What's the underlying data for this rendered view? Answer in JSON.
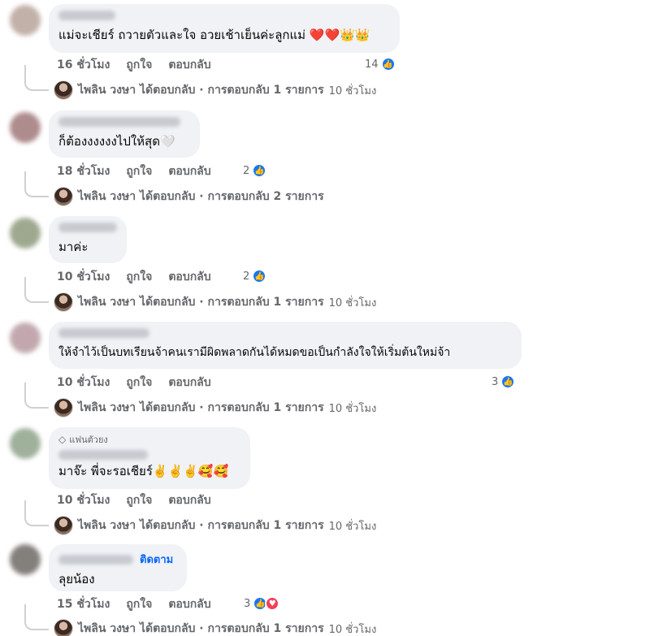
{
  "colors": {
    "bubble": "#f0f2f5",
    "like": "#1877f2",
    "heart": "#f33e58",
    "follow": "#0866ff",
    "muted": "#65676b"
  },
  "actions": {
    "like_label": "ถูกใจ",
    "reply_label": "ตอบกลับ"
  },
  "comments": [
    {
      "text": "แม่จะเชียร์ ถวายตัวและใจ อวยเช้าเย็นค่ะลูกแม่ ❤️❤️👑👑",
      "time": "16 ชั่วโมง",
      "reactions": "14",
      "reply": {
        "text": "ไพลิน วงษา ได้ตอบกลับ · การตอบกลับ 1 รายการ",
        "time": "10 ชั่วโมง"
      }
    },
    {
      "text": "ก็ต้องงงงงงไปให้สุด🤍",
      "time": "18 ชั่วโมง",
      "reactions": "2",
      "reply": {
        "text": "ไพลิน วงษา ได้ตอบกลับ · การตอบกลับ 2 รายการ",
        "time": ""
      }
    },
    {
      "text": "มาค่ะ",
      "time": "10 ชั่วโมง",
      "reactions": "2",
      "reply": {
        "text": "ไพลิน วงษา ได้ตอบกลับ · การตอบกลับ 1 รายการ",
        "time": "10 ชั่วโมง"
      }
    },
    {
      "text": "ให้จำไว้เป็นบทเรียนจ้าคนเรามีผิดพลาดกันได้หมดขอเป็นกำลังใจให้เริ่มต้นใหม่จ้า",
      "time": "10 ชั่วโมง",
      "reactions": "3",
      "reply": {
        "text": "ไพลิน วงษา ได้ตอบกลับ · การตอบกลับ 1 รายการ",
        "time": "10 ชั่วโมง"
      }
    },
    {
      "badge": "แฟนตัวยง",
      "text": "มาจ๊ะ พี่จะรอเชียร์✌️✌️✌️🥰🥰",
      "time": "10 ชั่วโมง",
      "reactions": "",
      "reply": {
        "text": "ไพลิน วงษา ได้ตอบกลับ · การตอบกลับ 1 รายการ",
        "time": "10 ชั่วโมง"
      }
    },
    {
      "follow": "ติดตาม",
      "text": "ลุยน้อง",
      "time": "15 ชั่วโมง",
      "reactions": "3",
      "reply": {
        "text": "ไพลิน วงษา ได้ตอบกลับ · การตอบกลับ 1 รายการ",
        "time": "10 ชั่วโมง"
      }
    }
  ]
}
